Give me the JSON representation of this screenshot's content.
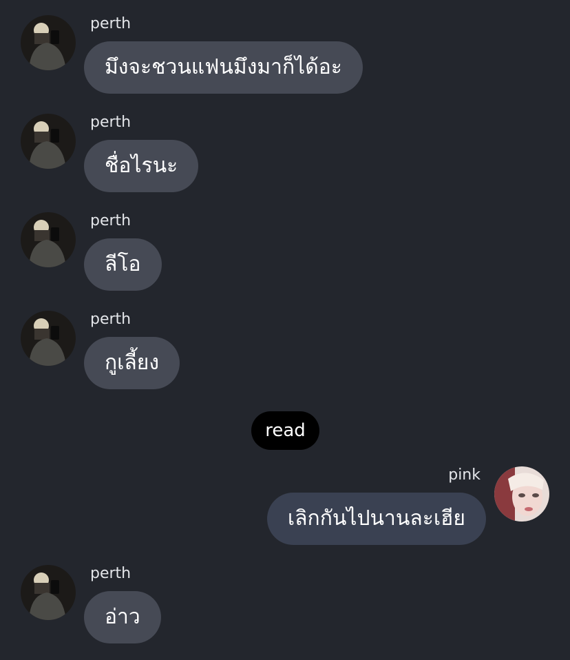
{
  "messages": [
    {
      "sender": "perth",
      "text": "มึงจะชวนแฟนมึงมาก็ได้อะ"
    },
    {
      "sender": "perth",
      "text": "ชื่อไรนะ"
    },
    {
      "sender": "perth",
      "text": "ลีโอ"
    },
    {
      "sender": "perth",
      "text": "กูเลี้ยง"
    },
    {
      "sender": "pink",
      "text": "เลิกกันไปนานละเฮีย"
    },
    {
      "sender": "perth",
      "text": "อ่าว"
    }
  ],
  "read_receipt": "read",
  "colors": {
    "background": "#23262d",
    "incoming_bubble": "#464a55",
    "outgoing_bubble": "#3a4152",
    "read_pill": "#000000",
    "text": "#ffffff"
  }
}
